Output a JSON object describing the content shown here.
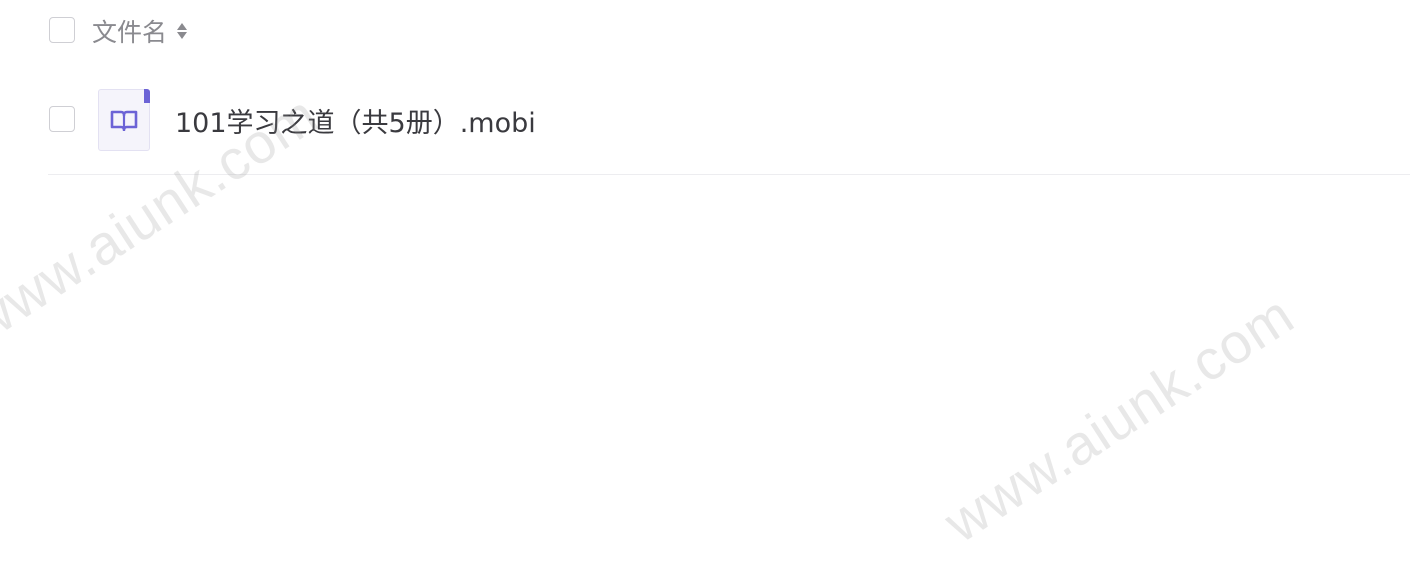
{
  "table": {
    "header": {
      "label": "文件名",
      "sort_icon": "sort-updown-icon"
    },
    "rows": [
      {
        "name": "101学习之道（共5册）.mobi",
        "icon": "ebook-icon",
        "icon_color": "#6c63d6"
      }
    ]
  },
  "watermark": {
    "text": "www.aiunk.com"
  }
}
